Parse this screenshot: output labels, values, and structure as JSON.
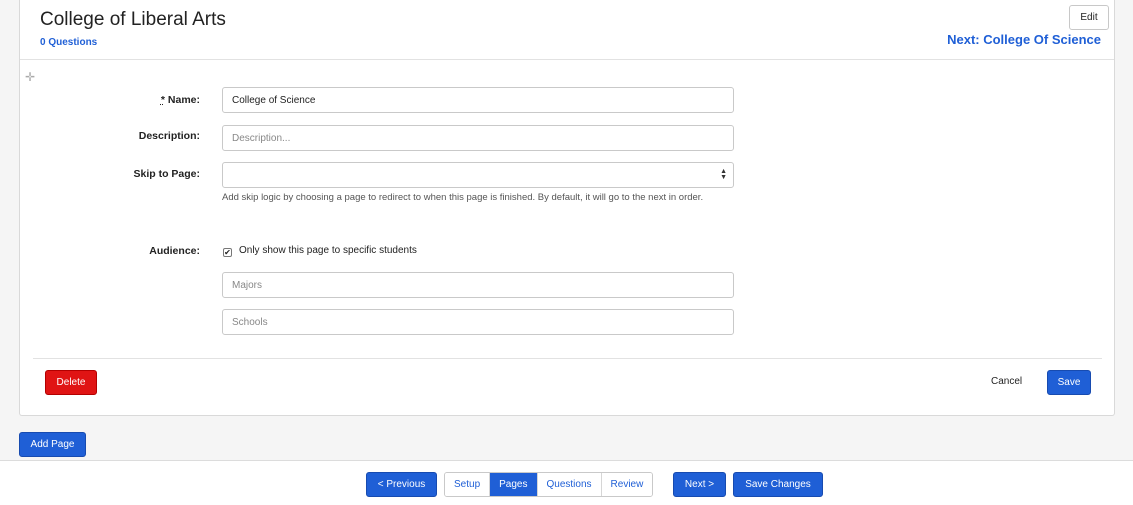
{
  "header": {
    "title": "College of Liberal Arts",
    "question_count": "0 Questions",
    "edit_label": "Edit",
    "next_link": "Next: College Of Science"
  },
  "form": {
    "name_required_mark": "*",
    "name_label": " Name:",
    "name_value": "College of Science",
    "description_label": "Description:",
    "description_placeholder": "Description...",
    "skip_label": "Skip to Page:",
    "skip_help": "Add skip logic by choosing a page to redirect to when this page is finished. By default, it will go to the next in order.",
    "audience_label": "Audience:",
    "audience_checked": true,
    "audience_checkbox_label": "Only show this page to specific students",
    "majors_placeholder": "Majors",
    "schools_placeholder": "Schools"
  },
  "actions": {
    "delete_label": "Delete",
    "cancel_label": "Cancel",
    "save_label": "Save"
  },
  "add_page_label": "Add Page",
  "footer": {
    "previous_label": "< Previous",
    "tabs": [
      {
        "label": "Setup",
        "active": false
      },
      {
        "label": "Pages",
        "active": true
      },
      {
        "label": "Questions",
        "active": false
      },
      {
        "label": "Review",
        "active": false
      }
    ],
    "next_label": "Next >",
    "save_changes_label": "Save Changes"
  },
  "colors": {
    "primary": "#1f5fd6",
    "danger": "#e01414"
  }
}
